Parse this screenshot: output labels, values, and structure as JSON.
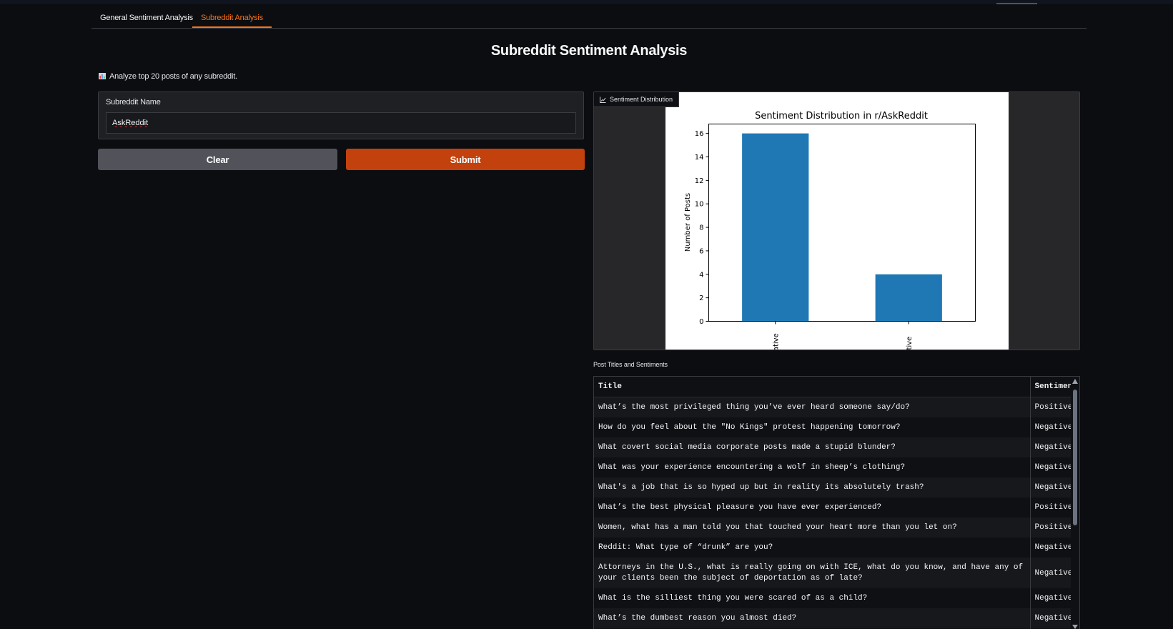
{
  "tabs": [
    {
      "label": "General Sentiment Analysis",
      "active": false
    },
    {
      "label": "Subreddit Analysis",
      "active": true
    }
  ],
  "page": {
    "title": "Subreddit Sentiment Analysis",
    "description": "Analyze top 20 posts of any subreddit.",
    "description_icon": "bar-chart-emoji"
  },
  "form": {
    "label": "Subreddit Name",
    "value": "AskReddit",
    "clear_label": "Clear",
    "submit_label": "Submit"
  },
  "plot": {
    "label": "Sentiment Distribution",
    "icon": "chart-line-icon"
  },
  "chart_data": {
    "type": "bar",
    "title": "Sentiment Distribution in r/AskReddit",
    "categories": [
      "Negative",
      "Positive"
    ],
    "visible_tick_text": [
      "gative",
      "sitive"
    ],
    "values": [
      16,
      4
    ],
    "xlabel": "",
    "ylabel": "Number of Posts",
    "ylim": [
      0,
      16.8
    ],
    "yticks": [
      0,
      2,
      4,
      6,
      8,
      10,
      12,
      14,
      16
    ],
    "bar_color": "#1f77b4",
    "grid": false
  },
  "table": {
    "label": "Post Titles and Sentiments",
    "columns": [
      "Title",
      "Sentimen"
    ],
    "rows": [
      {
        "title": "what’s the most privileged thing you’ve ever heard someone say/do?",
        "sentiment": "Positive"
      },
      {
        "title": "How do you feel about the \"No Kings\" protest happening tomorrow?",
        "sentiment": "Negative"
      },
      {
        "title": "What covert social media corporate posts made a stupid blunder?",
        "sentiment": "Negative"
      },
      {
        "title": "What was your experience encountering a wolf in sheep’s clothing?",
        "sentiment": "Negative"
      },
      {
        "title": "What's a job that is so hyped up but in reality its absolutely trash?",
        "sentiment": "Negative"
      },
      {
        "title": "What’s the best physical pleasure you have ever experienced?",
        "sentiment": "Positive"
      },
      {
        "title": "Women, what has a man told you that touched your heart more than you let on?",
        "sentiment": "Positive"
      },
      {
        "title": "Reddit: What type of “drunk” are you?",
        "sentiment": "Negative"
      },
      {
        "title": "Attorneys in the U.S., what is really going on with ICE, what do you know, and have any of your clients been the subject of deportation as of late?",
        "sentiment": "Negative"
      },
      {
        "title": "What is the silliest thing you were scared of as a child?",
        "sentiment": "Negative"
      },
      {
        "title": "What’s the dumbest reason you almost died?",
        "sentiment": "Negative"
      },
      {
        "title": "",
        "sentiment": ""
      }
    ]
  },
  "colors": {
    "accent": "#f97316",
    "submit_bg": "#c2410c",
    "clear_bg": "#52525b",
    "background": "#0c0d10"
  }
}
